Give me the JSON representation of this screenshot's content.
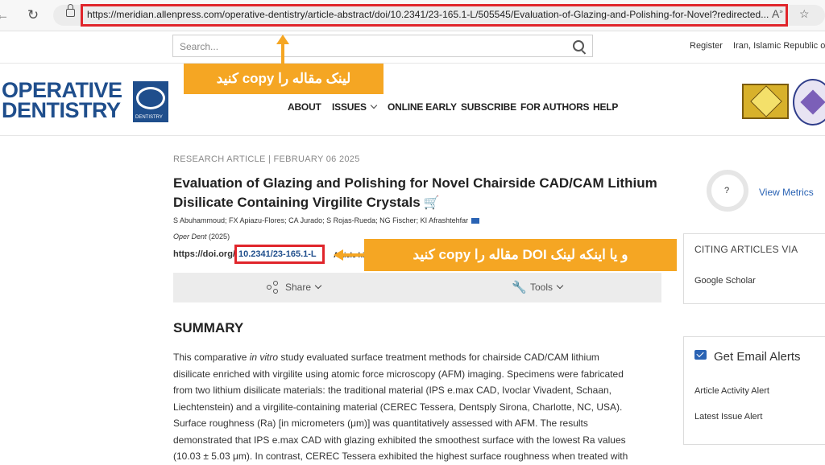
{
  "browser": {
    "url": "https://meridian.allenpress.com/operative-dentistry/article-abstract/doi/10.2341/23-165.1-L/505545/Evaluation-of-Glazing-and-Polishing-for-Novel?redirected...",
    "back_icon": "arrow-left-icon",
    "reload_icon": "reload-icon"
  },
  "header": {
    "search_placeholder": "Search...",
    "register": "Register",
    "country": "Iran, Islamic Republic of",
    "logo_line1": "OPERATIVE",
    "logo_line2": "DENTISTRY",
    "logo_small": "DENTISTRY"
  },
  "nav": {
    "items": [
      "ABOUT",
      "ISSUES",
      "ONLINE EARLY",
      "SUBSCRIBE",
      "FOR AUTHORS",
      "HELP"
    ]
  },
  "callouts": {
    "copy_article_link": "لینک مقاله را copy کنید",
    "copy_doi_link": "و یا اینکه لینک DOI مقاله را copy کنید"
  },
  "article": {
    "meta": "RESEARCH ARTICLE  |  FEBRUARY 06 2025",
    "title": "Evaluation of Glazing and Polishing for Novel Chairside CAD/CAM Lithium Disilicate Containing Virgilite Crystals",
    "authors": "S Abuhammoud; FX Apiazu-Flores; CA Jurado; S Rojas-Rueda; NG Fischer; KI Afrashtehfar",
    "journal_name": "Oper Dent",
    "journal_year": "(2025)",
    "doi_prefix": "https://doi.org/",
    "doi_id": "10.2341/23-165.1-L",
    "doi_tail": "Article history",
    "share_label": "Share",
    "tools_label": "Tools",
    "summary_heading": "SUMMARY",
    "summary_lines": [
      "This comparative in vitro study evaluated surface treatment methods for chairside CAD/CAM lithium",
      "disilicate enriched with virgilite using atomic force microscopy (AFM) imaging. Specimens were fabricated",
      "from two lithium disilicate materials: the traditional material (IPS e.max CAD, Ivoclar Vivadent, Schaan,",
      "Liechtenstein) and a virgilite-containing material (CEREC Tessera, Dentsply Sirona, Charlotte, NC, USA).",
      "Surface roughness (Ra) [in micrometers (μm)] was quantitatively assessed with AFM. The results",
      "demonstrated that IPS e.max CAD with glazing exhibited the smoothest surface with the lowest Ra values",
      "(10.03 ± 5.03 μm). In contrast, CEREC Tessera exhibited the highest surface roughness when treated with"
    ]
  },
  "sidebar": {
    "metrics_q": "?",
    "view_metrics": "View Metrics",
    "citing_heading": "CITING ARTICLES VIA",
    "google_scholar": "Google Scholar",
    "email_heading": "Get Email Alerts",
    "alert1": "Article Activity Alert",
    "alert2": "Latest Issue Alert"
  },
  "colors": {
    "highlight_box": "#e0252b",
    "callout": "#f5a623",
    "brand": "#1f4e8c",
    "link": "#2a63b4"
  }
}
